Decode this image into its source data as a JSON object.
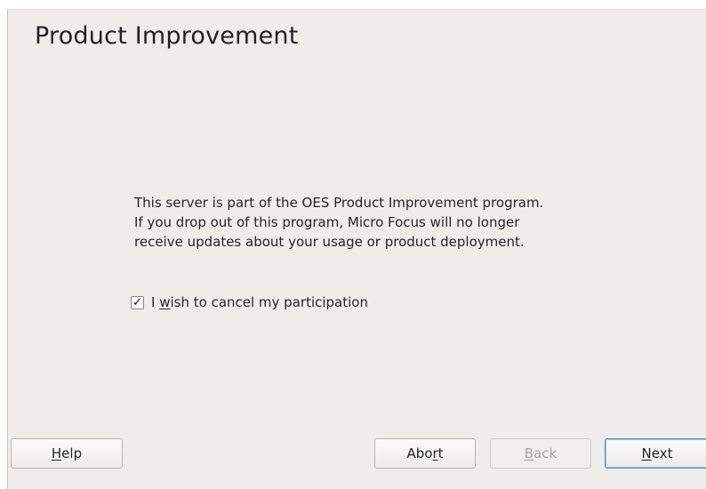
{
  "page": {
    "title": "Product Improvement",
    "description_lines": [
      "This server is part of the OES Product Improvement program.",
      "If you drop out of this program, Micro Focus will no longer",
      "receive updates about your usage or product deployment."
    ]
  },
  "cancel_checkbox": {
    "checked": true,
    "check_mark": "✓",
    "label_before": "I ",
    "label_mnemonic": "w",
    "label_after": "ish to cancel my participation"
  },
  "buttons": {
    "help": {
      "before": "",
      "mnemonic": "H",
      "after": "elp",
      "enabled": true
    },
    "abort": {
      "before": "Abo",
      "mnemonic": "r",
      "after": "t",
      "enabled": true
    },
    "back": {
      "before": "",
      "mnemonic": "B",
      "after": "ack",
      "enabled": false
    },
    "next": {
      "before": "",
      "mnemonic": "N",
      "after": "ext",
      "enabled": true
    }
  },
  "colors": {
    "window_bg": "#efedea",
    "focus_border": "#3f8ecb"
  }
}
